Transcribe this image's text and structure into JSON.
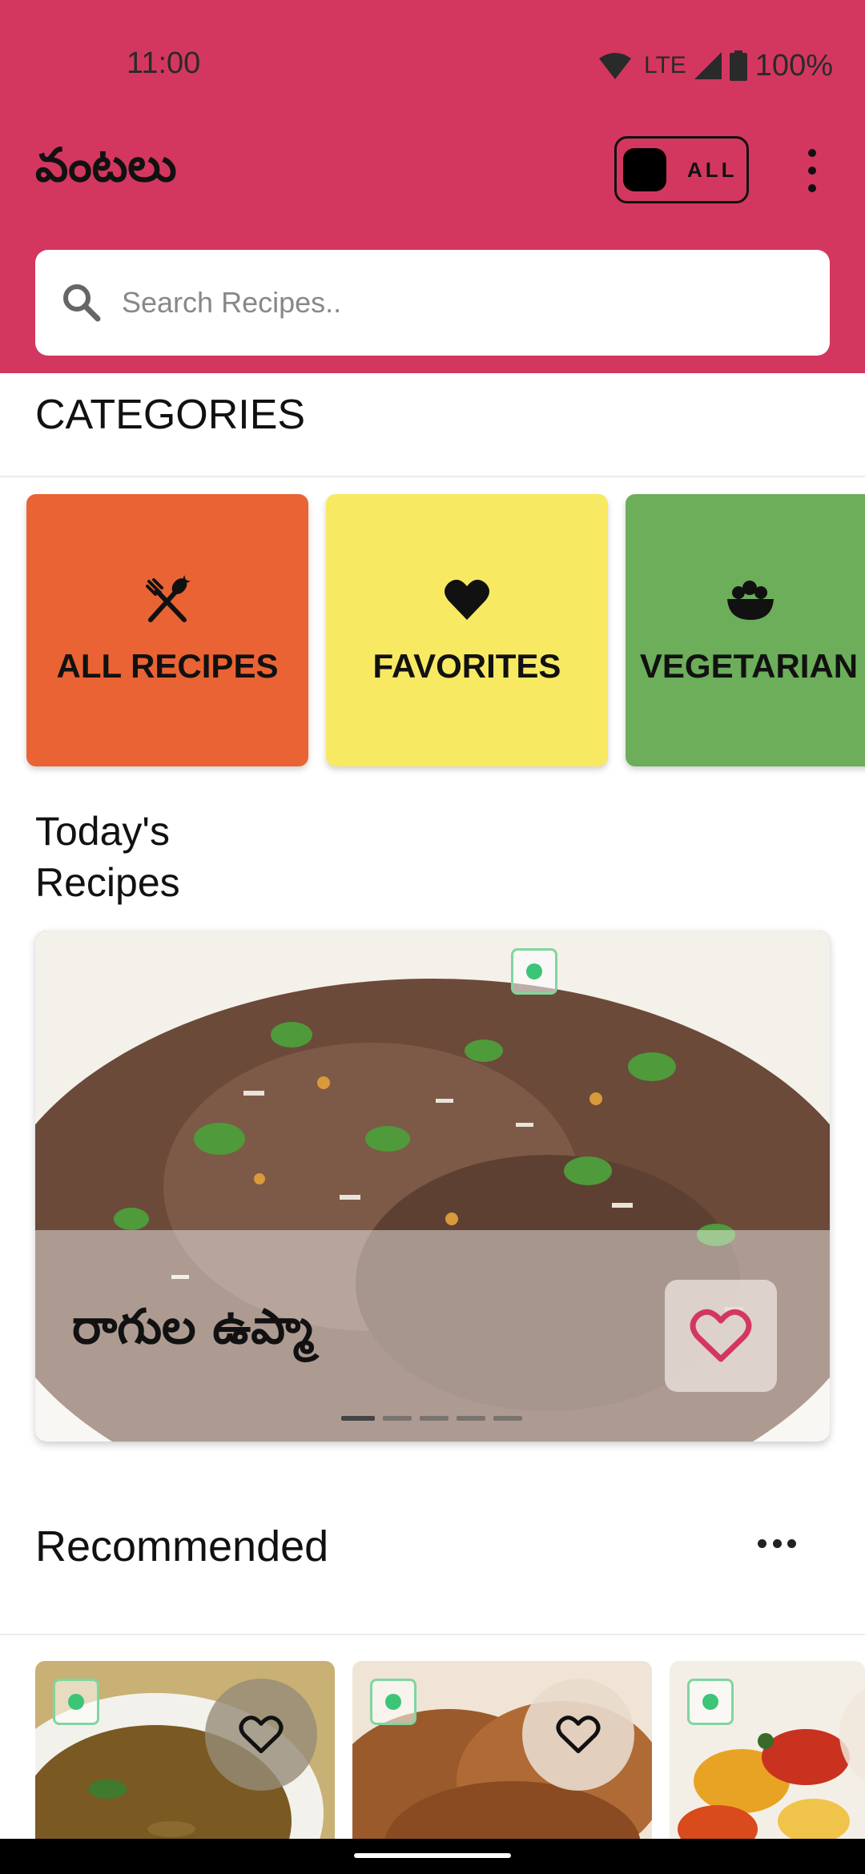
{
  "status_bar": {
    "time": "11:00",
    "network": "LTE",
    "battery": "100%"
  },
  "header": {
    "title": "వంటలు",
    "toggle_label": "ALL",
    "search_placeholder": "Search Recipes.."
  },
  "categories": {
    "title": "CATEGORIES",
    "items": [
      {
        "label": "ALL RECIPES",
        "icon": "utensils-icon",
        "color": "#ea6334"
      },
      {
        "label": "FAVORITES",
        "icon": "heart-icon",
        "color": "#f8e963"
      },
      {
        "label": "VEGETARIAN",
        "icon": "salad-bowl-icon",
        "color": "#6cae5a"
      }
    ]
  },
  "today": {
    "title": "Today's\nRecipes",
    "title_line1": "Today's",
    "title_line2": "Recipes",
    "recipe_name": "రాగుల ఉప్మా",
    "carousel_pages": 5,
    "active_page": 1
  },
  "recommended": {
    "title": "Recommended"
  },
  "colors": {
    "header": "#d3375f",
    "heart_accent": "#d3375f",
    "veg_badge": "#3cc477"
  }
}
